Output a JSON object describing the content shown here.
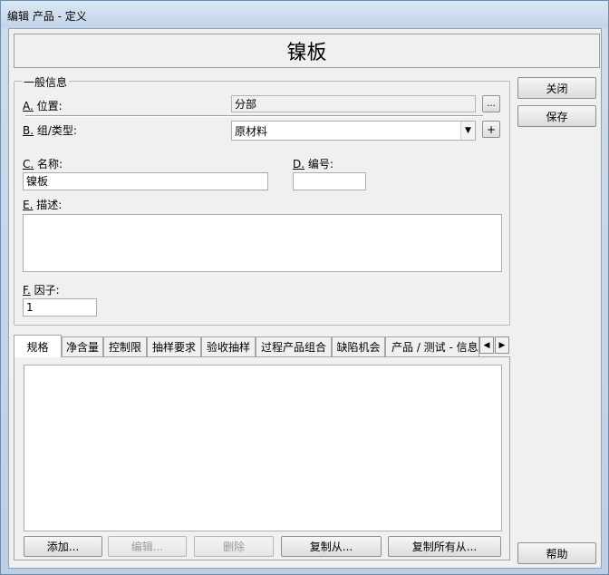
{
  "window": {
    "title": "编辑 产品 - 定义"
  },
  "header": {
    "title": "镍板"
  },
  "general": {
    "legend": "一般信息",
    "location": {
      "key": "A.",
      "label": " 位置:",
      "value": "分部",
      "browse_label": "..."
    },
    "group_type": {
      "key": "B.",
      "label": " 组/类型:",
      "value": "原材料",
      "add_label": "+"
    },
    "name": {
      "key": "C.",
      "label": " 名称:",
      "value": "镍板"
    },
    "number": {
      "key": "D.",
      "label": " 编号:",
      "value": ""
    },
    "description": {
      "key": "E.",
      "label": " 描述:",
      "value": ""
    },
    "factor": {
      "key": "F.",
      "label": " 因子:",
      "value": "1"
    }
  },
  "side_buttons": {
    "close": "关闭",
    "save": "保存",
    "help": "帮助"
  },
  "tabs": [
    {
      "label": "规格"
    },
    {
      "label": "净含量"
    },
    {
      "label": "控制限"
    },
    {
      "label": "抽样要求"
    },
    {
      "label": "验收抽样"
    },
    {
      "label": "过程产品组合"
    },
    {
      "label": "缺陷机会"
    },
    {
      "label": "产品 / 测试 - 信息"
    }
  ],
  "tab_actions": {
    "add": "添加...",
    "edit": "编辑...",
    "delete": "删除",
    "copy_from": "复制从...",
    "copy_all_from": "复制所有从..."
  }
}
